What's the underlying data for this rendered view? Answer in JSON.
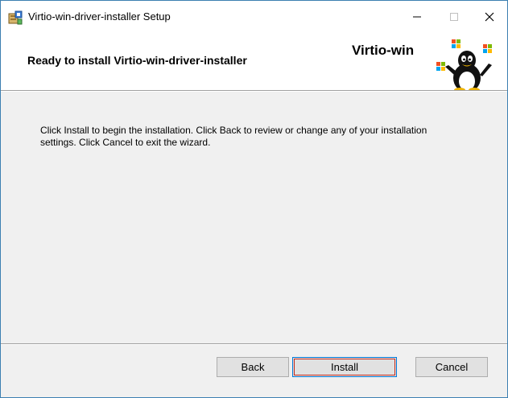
{
  "window": {
    "title": "Virtio-win-driver-installer Setup",
    "controls": {
      "minimize": "—",
      "maximize": "☐",
      "close": "✕"
    }
  },
  "banner": {
    "title": "Ready to install Virtio-win-driver-installer",
    "brand": "Virtio-win"
  },
  "body": {
    "text": "Click Install to begin the installation. Click Back to review or change any of your installation settings. Click Cancel to exit the wizard."
  },
  "buttons": {
    "back": "Back",
    "install": "Install",
    "cancel": "Cancel"
  },
  "colors": {
    "window_border": "#3c7fb1",
    "focus_border": "#0078d7",
    "dialog_bg": "#f0f0f0"
  }
}
